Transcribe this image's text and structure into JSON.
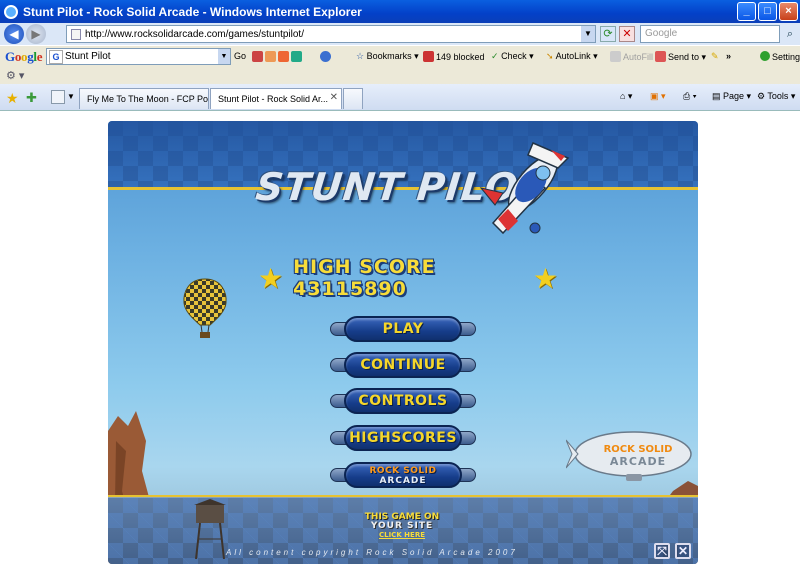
{
  "window": {
    "title": "Stunt Pilot - Rock Solid Arcade - Windows Internet Explorer"
  },
  "address_bar": {
    "url": "http://www.rocksolidarcade.com/games/stuntpilot/",
    "search_placeholder": "Google"
  },
  "google_toolbar": {
    "search_value": "Stunt Pilot",
    "go_label": "Go",
    "bookmarks_label": "Bookmarks",
    "blocked_label": "149 blocked",
    "check_label": "Check",
    "autolink_label": "AutoLink",
    "autofill_label": "AutoFill",
    "sendto_label": "Send to",
    "more_label": "»",
    "settings_label": "Settings"
  },
  "tabs": [
    {
      "label": "Fly Me To The Moon - FCP Po...",
      "active": false
    },
    {
      "label": "Stunt Pilot - Rock Solid Ar...",
      "active": true
    }
  ],
  "command_bar": {
    "page_label": "Page",
    "tools_label": "Tools"
  },
  "game": {
    "title": "STUNT PILOT",
    "high_score_label": "HIGH SCORE",
    "high_score_value": "43115890",
    "menu": [
      {
        "label": "PLAY"
      },
      {
        "label": "CONTINUE"
      },
      {
        "label": "CONTROLS"
      },
      {
        "label": "HIGHSCORES"
      }
    ],
    "rsa_button": {
      "line1": "ROCK SOLID",
      "line2": "ARCADE"
    },
    "blimp": {
      "line1": "ROCK SOLID",
      "line2": "ARCADE"
    },
    "promo": {
      "line1": "THIS GAME ON",
      "line2": "YOUR SITE",
      "line3": "CLICK HERE"
    },
    "copyright": "All content copyright Rock Solid Arcade 2007"
  }
}
